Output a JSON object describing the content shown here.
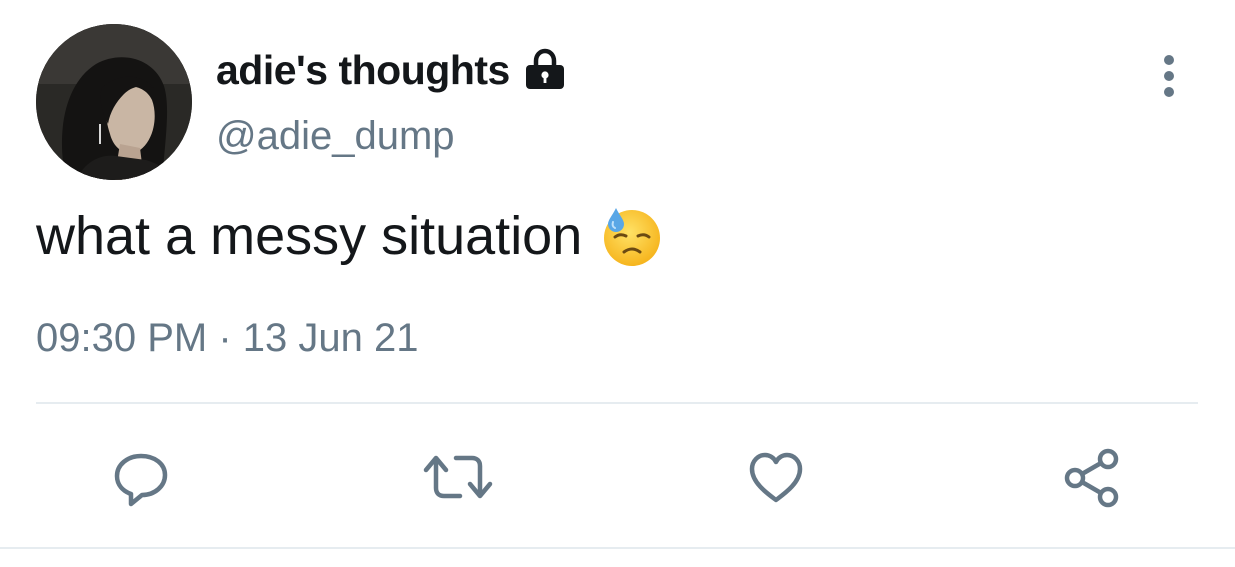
{
  "user": {
    "display_name": "adie's thoughts",
    "handle": "@adie_dump",
    "protected_icon": "lock-icon",
    "avatar_icon": "avatar-photo"
  },
  "tweet": {
    "text": "what a messy situation",
    "emoji_icon": "downcast-face-with-sweat-emoji",
    "timestamp": "09:30 PM · 13 Jun 21"
  },
  "actions": [
    {
      "icon": "reply-icon"
    },
    {
      "icon": "retweet-icon"
    },
    {
      "icon": "like-icon"
    },
    {
      "icon": "share-icon"
    }
  ],
  "menu": {
    "icon": "more-vertical-icon"
  },
  "colors": {
    "text_primary": "#14171a",
    "text_secondary": "#657786",
    "icon": "#657786",
    "divider": "#e6ecf0",
    "background": "#ffffff"
  }
}
